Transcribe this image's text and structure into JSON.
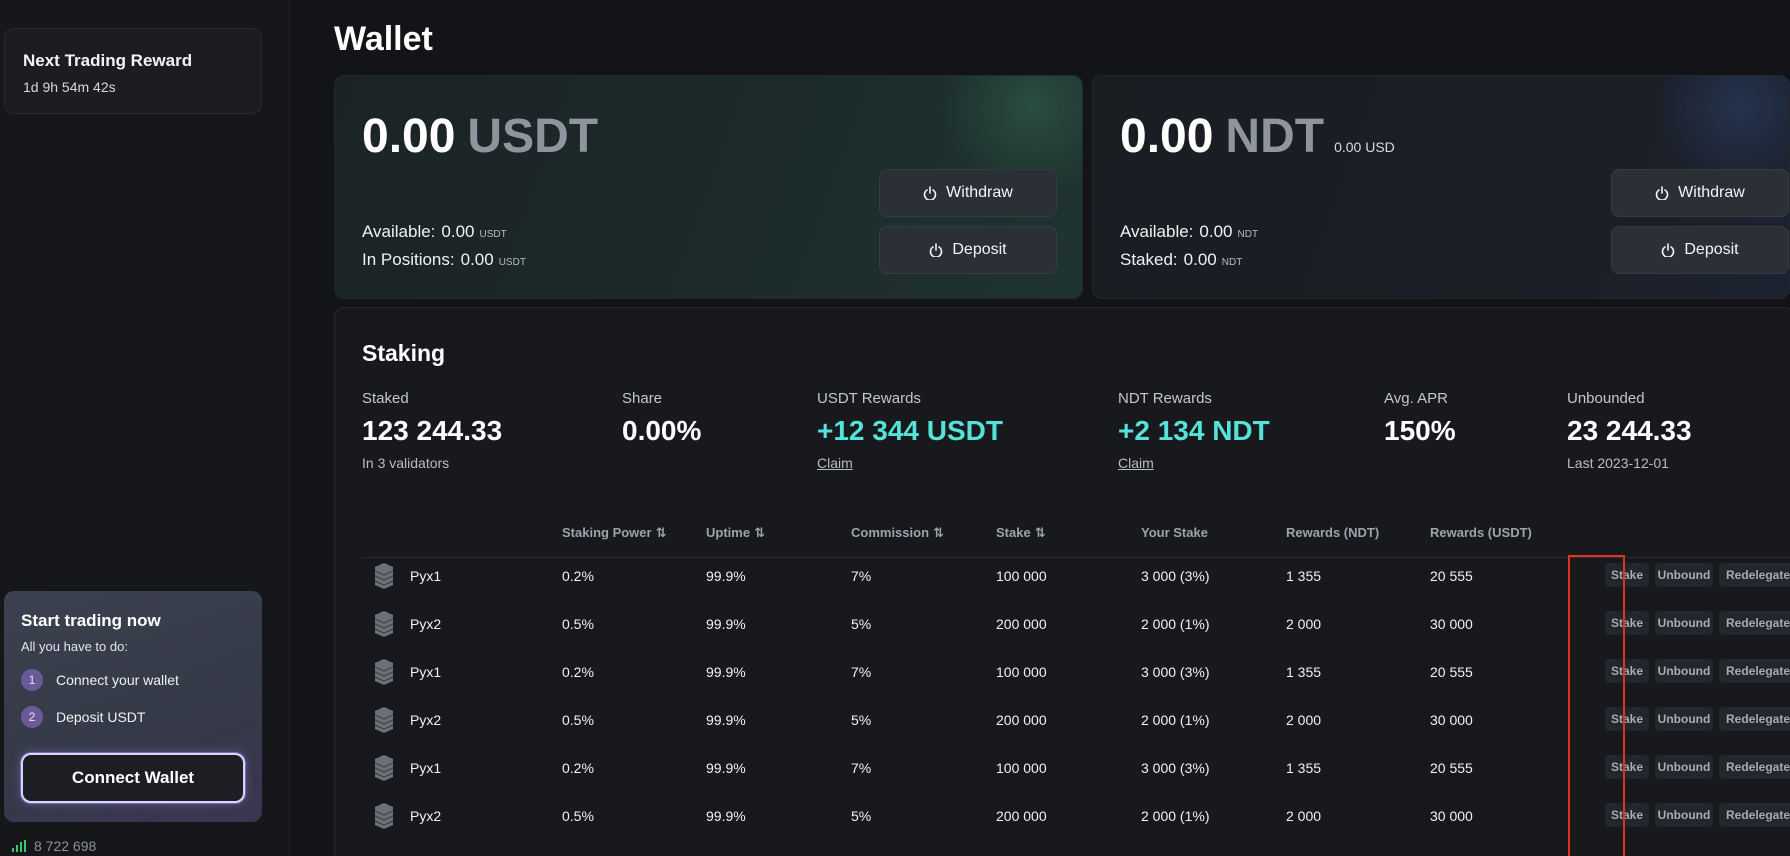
{
  "sidebar": {
    "next_reward": {
      "title": "Next Trading Reward",
      "countdown": "1d 9h 54m 42s"
    },
    "start_trading": {
      "title": "Start trading now",
      "subtitle": "All you have to do:",
      "steps": [
        {
          "num": "1",
          "label": "Connect your wallet"
        },
        {
          "num": "2",
          "label": "Deposit USDT"
        }
      ],
      "connect_button": "Connect Wallet"
    },
    "footer_stat": "8 722 698"
  },
  "page": {
    "title": "Wallet"
  },
  "usdt_card": {
    "amount": "0.00",
    "currency": "USDT",
    "available_label": "Available:",
    "available_value": "0.00",
    "available_unit": "USDT",
    "positions_label": "In Positions:",
    "positions_value": "0.00",
    "positions_unit": "USDT",
    "withdraw_label": "Withdraw",
    "deposit_label": "Deposit"
  },
  "ndt_card": {
    "amount": "0.00",
    "currency": "NDT",
    "usd_equiv": "0.00 USD",
    "available_label": "Available:",
    "available_value": "0.00",
    "available_unit": "NDT",
    "staked_label": "Staked:",
    "staked_value": "0.00",
    "staked_unit": "NDT",
    "withdraw_label": "Withdraw",
    "deposit_label": "Deposit"
  },
  "staking": {
    "title": "Staking",
    "stats": {
      "staked": {
        "label": "Staked",
        "value": "123 244.33",
        "sub": "In 3 validators"
      },
      "share": {
        "label": "Share",
        "value": "0.00%"
      },
      "usdt_rewards": {
        "label": "USDT Rewards",
        "value": "+12 344 USDT",
        "link": "Claim"
      },
      "ndt_rewards": {
        "label": "NDT Rewards",
        "value": "+2 134 NDT",
        "link": "Claim"
      },
      "apr": {
        "label": "Avg. APR",
        "value": "150%"
      },
      "unbounded": {
        "label": "Unbounded",
        "value": "23 244.33",
        "sub": "Last 2023-12-01"
      }
    },
    "columns": {
      "power": "Staking Power",
      "uptime": "Uptime",
      "commission": "Commission",
      "stake": "Stake",
      "your_stake": "Your Stake",
      "rewards_ndt": "Rewards (NDT)",
      "rewards_usdt": "Rewards (USDT)",
      "sort_glyph": "⇅"
    },
    "actions": {
      "stake": "Stake",
      "unbound": "Unbound",
      "redelegate": "Redelegate"
    },
    "rows": [
      {
        "name": "Pyx1",
        "power": "0.2%",
        "uptime": "99.9%",
        "commission": "7%",
        "stake": "100 000",
        "your_stake": "3 000 (3%)",
        "rewards_ndt": "1 355",
        "rewards_usdt": "20 555"
      },
      {
        "name": "Pyx2",
        "power": "0.5%",
        "uptime": "99.9%",
        "commission": "5%",
        "stake": "200 000",
        "your_stake": "2 000 (1%)",
        "rewards_ndt": "2 000",
        "rewards_usdt": "30 000"
      },
      {
        "name": "Pyx1",
        "power": "0.2%",
        "uptime": "99.9%",
        "commission": "7%",
        "stake": "100 000",
        "your_stake": "3 000 (3%)",
        "rewards_ndt": "1 355",
        "rewards_usdt": "20 555"
      },
      {
        "name": "Pyx2",
        "power": "0.5%",
        "uptime": "99.9%",
        "commission": "5%",
        "stake": "200 000",
        "your_stake": "2 000 (1%)",
        "rewards_ndt": "2 000",
        "rewards_usdt": "30 000"
      },
      {
        "name": "Pyx1",
        "power": "0.2%",
        "uptime": "99.9%",
        "commission": "7%",
        "stake": "100 000",
        "your_stake": "3 000 (3%)",
        "rewards_ndt": "1 355",
        "rewards_usdt": "20 555"
      },
      {
        "name": "Pyx2",
        "power": "0.5%",
        "uptime": "99.9%",
        "commission": "5%",
        "stake": "200 000",
        "your_stake": "2 000 (1%)",
        "rewards_ndt": "2 000",
        "rewards_usdt": "30 000"
      }
    ]
  },
  "colors": {
    "background": "#121418",
    "accent_teal": "#55e3d9",
    "highlight_red": "#e0331f",
    "step_badge": "#6b5a9a"
  }
}
